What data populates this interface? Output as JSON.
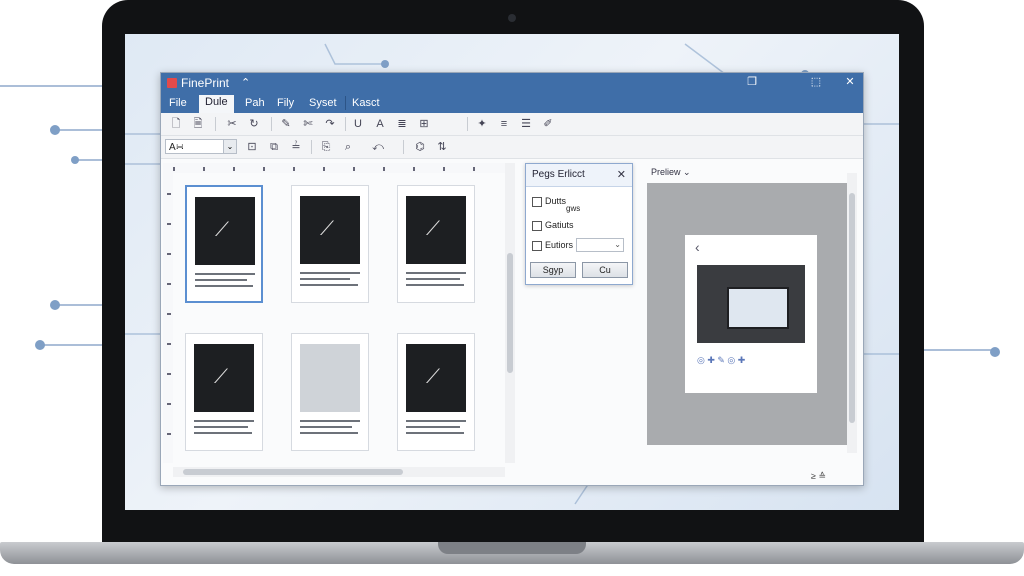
{
  "app": {
    "title": "FinePrint",
    "collapse_glyph": "⌃",
    "window_controls": [
      "❐",
      "⬚",
      "✕"
    ]
  },
  "menu": [
    "File",
    "Dule",
    "Pah",
    "Fily",
    "Syset",
    "Kasct"
  ],
  "menu_active_index": 1,
  "toolbar": {
    "font_value": "A∺",
    "font_dropdown_glyph": "⌄",
    "row1_icons": [
      "new-page-icon",
      "save-icon",
      "cut-icon",
      "rotate-icon",
      "brush-icon",
      "scissors-icon",
      "redo-icon",
      "underline-icon",
      "text-color-icon",
      "list-icon",
      "stamp-icon",
      "pin-icon",
      "align-icon",
      "lines-icon",
      "pen-icon"
    ],
    "row1_glyphs": [
      "🗋",
      "🗎",
      "✂",
      "↻",
      "✎",
      "✄",
      "↷",
      "U",
      "A",
      "≣",
      "⊞",
      "✦",
      "≡",
      "☰",
      "✐"
    ],
    "row2_glyphs": [
      "⊡",
      "⧉",
      "≟",
      "⎘",
      "⌕",
      "⤺",
      "⌬",
      "⇅"
    ]
  },
  "dialog": {
    "title": "Pegs Erlicct",
    "close_glyph": "✕",
    "options": [
      "Dutts",
      "Gatiuts",
      "Eutiors"
    ],
    "option_sub": "gws",
    "select_glyph": "⌄",
    "ok_label": "Sgyp",
    "cancel_label": "Cu"
  },
  "preview": {
    "label": "Preliew",
    "label_glyph": "⌄",
    "back_glyph": "‹",
    "icons": "◎ ✚ ✎      ◎ ✚"
  },
  "statusbar": {
    "glyphs": "≥ ≙"
  },
  "pages": [
    {
      "type": "dark",
      "selected": true
    },
    {
      "type": "dark",
      "selected": false
    },
    {
      "type": "dark",
      "selected": false
    },
    {
      "type": "dark",
      "selected": false
    },
    {
      "type": "photo",
      "selected": false
    },
    {
      "type": "dark",
      "selected": false
    }
  ],
  "colors": {
    "titlebar": "#3f6ea8",
    "selection": "#5b8fd1",
    "preview_bg": "#a9abae"
  }
}
